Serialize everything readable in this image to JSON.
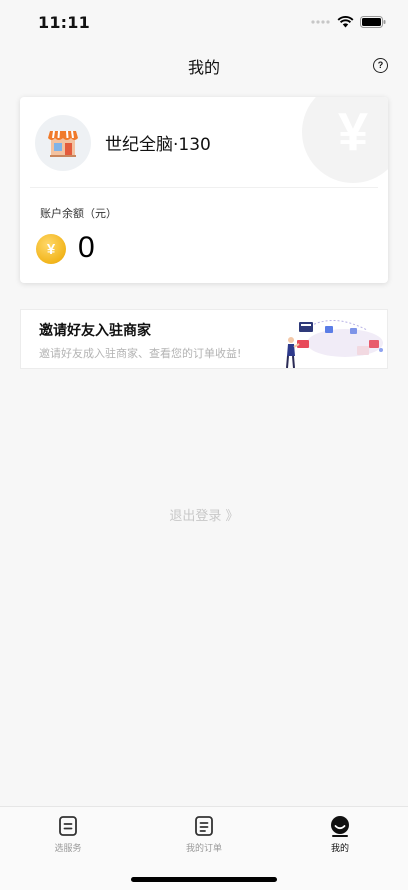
{
  "status_bar": {
    "time": "11:11",
    "icons": [
      "signal-dots-icon",
      "wifi-icon",
      "battery-icon"
    ]
  },
  "nav": {
    "title": "我的",
    "help_icon": "question-circle-icon",
    "help_glyph": "?"
  },
  "account_card": {
    "shop_name": "世纪全脑·130",
    "avatar_icon": "storefront-icon",
    "watermark_icon": "yen-icon",
    "watermark_glyph": "¥",
    "balance_label": "账户余额（元）",
    "balance_value": "0",
    "coin_icon": "gold-coin-icon",
    "coin_glyph": "¥"
  },
  "invite_banner": {
    "title": "邀请好友入驻商家",
    "subtitle": "邀请好友成入驻商家、查看您的订单收益!",
    "illustration": "invite-illustration"
  },
  "logout": {
    "label": "退出登录 》"
  },
  "tab_bar": {
    "items": [
      {
        "label": "选服务",
        "icon": "service-list-icon",
        "active": false
      },
      {
        "label": "我的订单",
        "icon": "orders-icon",
        "active": false
      },
      {
        "label": "我的",
        "icon": "profile-icon",
        "active": true
      }
    ]
  },
  "colors": {
    "background": "#f7f7f7",
    "card": "#ffffff",
    "coin_gold": "#f2b51c",
    "muted_text": "#b3b3b3",
    "active_tab": "#111111",
    "inactive_tab": "#9a9a9a"
  }
}
